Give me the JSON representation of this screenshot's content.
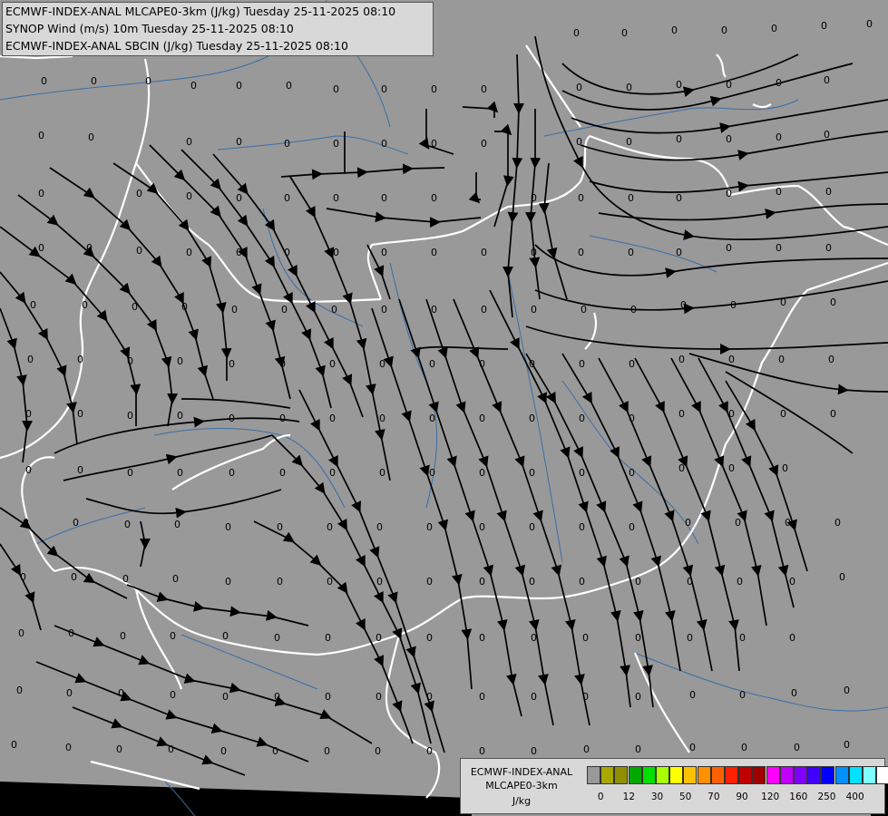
{
  "titles": [
    "ECMWF-INDEX-ANAL MLCAPE0-3km (J/kg) Tuesday 25-11-2025 08:10",
    "SYNOP Wind (m/s) 10m Tuesday 25-11-2025 08:10",
    "ECMWF-INDEX-ANAL SBCIN (J/kg) Tuesday 25-11-2025 08:10"
  ],
  "station_value": "0",
  "colors": {
    "land": "#999999",
    "border": "#ffffff",
    "river": "#3a6ea8",
    "streamline": "#000000",
    "sea": "#000000"
  },
  "legend": {
    "name_line1": "ECMWF-INDEX-ANAL",
    "name_line2": "MLCAPE0-3km",
    "unit": "J/kg",
    "swatches": [
      "#999999",
      "#a8a800",
      "#8f8f00",
      "#00a800",
      "#00e000",
      "#a8ff00",
      "#ffff00",
      "#ffc000",
      "#ff9000",
      "#ff6000",
      "#ff2000",
      "#c00000",
      "#a00000",
      "#ff00ff",
      "#c000ff",
      "#8000ff",
      "#4000ff",
      "#0000ff",
      "#0090ff",
      "#00e0ff",
      "#80ffff",
      "#ffffff"
    ],
    "ticks": [
      "0",
      "12",
      "30",
      "50",
      "70",
      "90",
      "120",
      "160",
      "250",
      "400"
    ]
  }
}
